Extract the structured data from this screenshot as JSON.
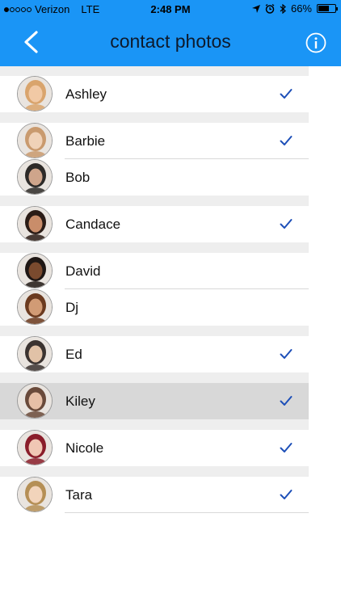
{
  "status_bar": {
    "carrier": "Verizon",
    "network": "LTE",
    "time": "2:48 PM",
    "battery": "66%",
    "battery_level": 0.66,
    "signal_bars": 1
  },
  "nav": {
    "title": "contact photos",
    "back_icon": "chevron-left-icon",
    "info_icon": "info-icon"
  },
  "colors": {
    "header": "#1a95f6",
    "check": "#1d4fb8",
    "selected_row": "#d8d8d8"
  },
  "contacts": [
    {
      "name": "Ashley",
      "checked": true
    },
    {
      "name": "Barbie",
      "checked": true
    },
    {
      "name": "Bob",
      "checked": false
    },
    {
      "name": "Candace",
      "checked": true
    },
    {
      "name": "David",
      "checked": false
    },
    {
      "name": "Dj",
      "checked": false
    },
    {
      "name": "Ed",
      "checked": true
    },
    {
      "name": "Kiley",
      "checked": true,
      "selected": true
    },
    {
      "name": "Nicole",
      "checked": true
    },
    {
      "name": "Tara",
      "checked": true
    }
  ]
}
